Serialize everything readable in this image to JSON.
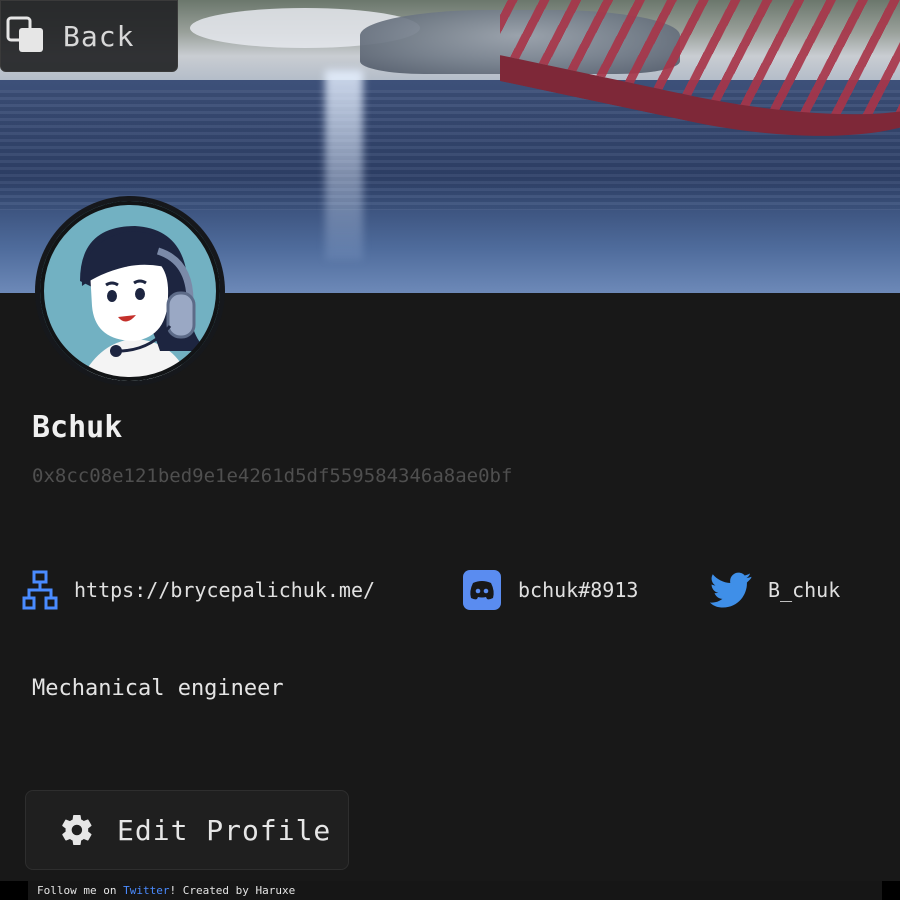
{
  "header": {
    "back_label": "Back"
  },
  "profile": {
    "name": "Bchuk",
    "address": "0x8cc08e121bed9e1e4261d5df559584346a8ae0bf",
    "bio": "Mechanical engineer"
  },
  "links": {
    "website": {
      "icon": "sitemap-icon",
      "text": "https://brycepalichuk.me/"
    },
    "discord": {
      "icon": "discord-icon",
      "text": "bchuk#8913"
    },
    "twitter": {
      "icon": "twitter-icon",
      "text": "B_chuk"
    }
  },
  "actions": {
    "edit_profile_label": "Edit Profile"
  },
  "footer": {
    "prefix": "Follow me on ",
    "link_text": "Twitter",
    "suffix": "! Created by Haruxe"
  },
  "colors": {
    "background": "#181818",
    "accent_blue": "#4a8bff",
    "discord_blue": "#5a8cf0",
    "twitter_blue": "#3f8fe8",
    "muted_text": "#4f4f4f"
  }
}
